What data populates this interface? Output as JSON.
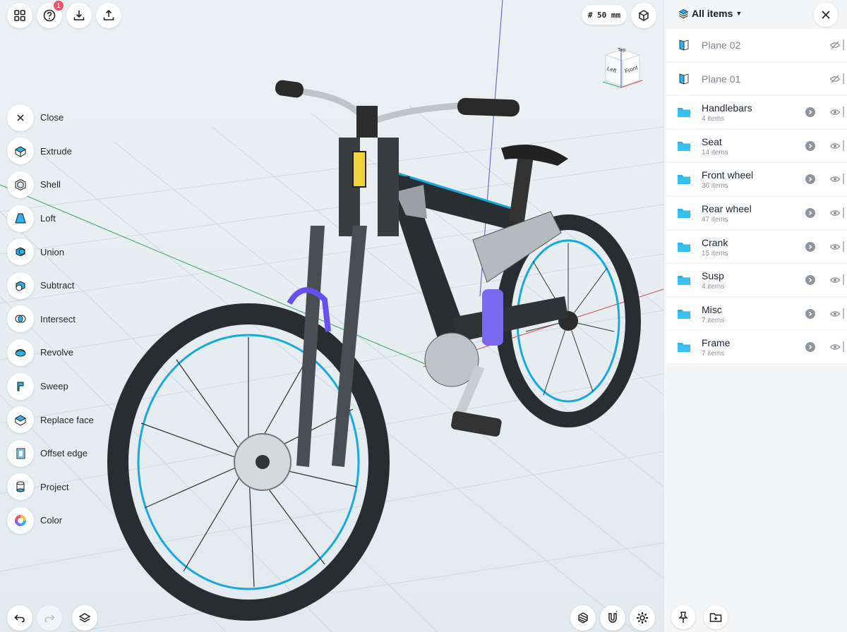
{
  "toolbar_top": {
    "help_badge": "1",
    "grid_size": "# 50 mm"
  },
  "view_cube": {
    "top_label": "Top",
    "left_label": "Left",
    "front_label": "Front"
  },
  "tools": [
    {
      "label": "Close",
      "icon": "close-icon"
    },
    {
      "label": "Extrude",
      "icon": "extrude-icon"
    },
    {
      "label": "Shell",
      "icon": "shell-icon"
    },
    {
      "label": "Loft",
      "icon": "loft-icon"
    },
    {
      "label": "Union",
      "icon": "union-icon"
    },
    {
      "label": "Subtract",
      "icon": "subtract-icon"
    },
    {
      "label": "Intersect",
      "icon": "intersect-icon"
    },
    {
      "label": "Revolve",
      "icon": "revolve-icon"
    },
    {
      "label": "Sweep",
      "icon": "sweep-icon"
    },
    {
      "label": "Replace face",
      "icon": "replace-face-icon"
    },
    {
      "label": "Offset edge",
      "icon": "offset-edge-icon"
    },
    {
      "label": "Project",
      "icon": "project-icon"
    },
    {
      "label": "Color",
      "icon": "color-wheel-icon"
    }
  ],
  "panel": {
    "title": "All items",
    "items": [
      {
        "name": "Plane 02",
        "sub": "",
        "type": "plane"
      },
      {
        "name": "Plane 01",
        "sub": "",
        "type": "plane"
      },
      {
        "name": "Handlebars",
        "sub": "4 items",
        "type": "folder"
      },
      {
        "name": "Seat",
        "sub": "14 items",
        "type": "folder"
      },
      {
        "name": "Front wheel",
        "sub": "36 items",
        "type": "folder"
      },
      {
        "name": "Rear wheel",
        "sub": "47 items",
        "type": "folder"
      },
      {
        "name": "Crank",
        "sub": "15 items",
        "type": "folder"
      },
      {
        "name": "Susp",
        "sub": "4 items",
        "type": "folder"
      },
      {
        "name": "Misc",
        "sub": "7 items",
        "type": "folder"
      },
      {
        "name": "Frame",
        "sub": "7 items",
        "type": "folder"
      }
    ]
  },
  "colors": {
    "accent": "#1fb4e6",
    "folder": "#29b6e8",
    "badge": "#f2506a",
    "suspension": "#7b68ee"
  }
}
